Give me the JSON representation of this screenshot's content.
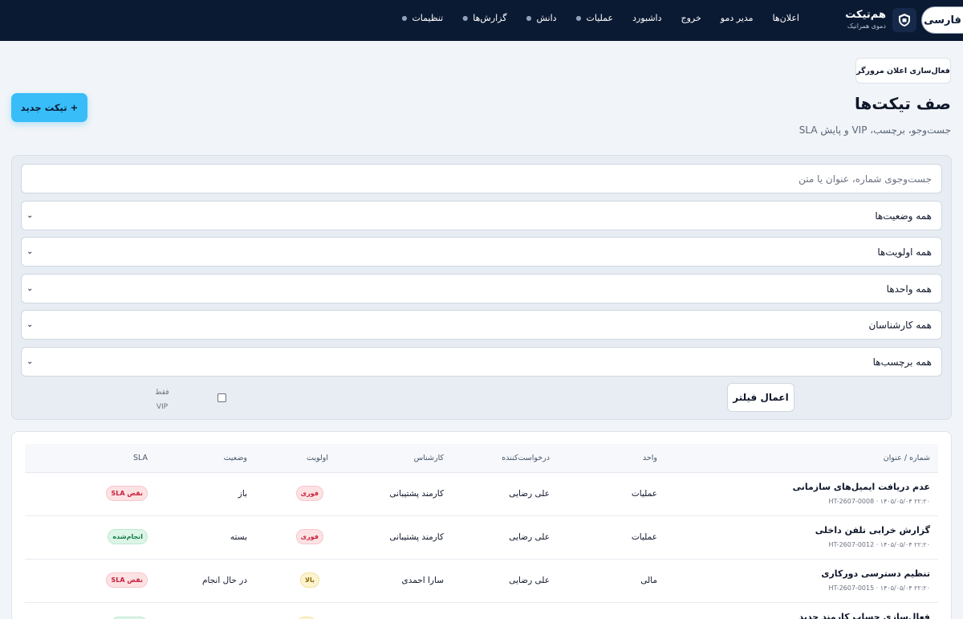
{
  "topbar": {
    "language": "فارسی",
    "brand_name": "هم‌تیکت",
    "brand_sub": "دموی همرانیک",
    "nav": [
      {
        "label": "اعلان‌ها",
        "dropdown": false
      },
      {
        "label": "مدیر دمو",
        "dropdown": false
      },
      {
        "label": "خروج",
        "dropdown": false
      },
      {
        "label": "داشبورد",
        "dropdown": false
      },
      {
        "label": "عملیات",
        "dropdown": true
      },
      {
        "label": "دانش",
        "dropdown": true
      },
      {
        "label": "گزارش‌ها",
        "dropdown": true
      },
      {
        "label": "تنظیمات",
        "dropdown": true
      }
    ]
  },
  "header": {
    "notify_button": "فعال‌سازی اعلان مرورگر",
    "title": "صف تیکت‌ها",
    "subtitle": "جست‌وجو، برچسب، VIP و پایش SLA",
    "new_ticket": "+ تیکت جدید"
  },
  "filters": {
    "search_placeholder": "جست‌وجوی شماره، عنوان یا متن",
    "status": "همه وضعیت‌ها",
    "priority": "همه اولویت‌ها",
    "unit": "همه واحدها",
    "agent": "همه کارشناسان",
    "tag": "همه برچسب‌ها",
    "vip_label_1": "فقط",
    "vip_label_2": "VIP",
    "vip_checked": false,
    "apply": "اعمال فیلتر"
  },
  "table": {
    "headers": {
      "title": "شماره / عنوان",
      "unit": "واحد",
      "requester": "درخواست‌کننده",
      "agent": "کارشناس",
      "priority": "اولویت",
      "status": "وضعیت",
      "sla": "SLA"
    },
    "rows": [
      {
        "title": "عدم دریافت ایمیل‌های سازمانی",
        "meta": "HT-2607-0008 · ۱۴۰۵/۰۵/۰۴ ۲۲:۲۰",
        "unit": "عملیات",
        "requester": "علی رضایی",
        "agent": "کارمند پشتیبانی",
        "priority": "فوری",
        "priority_color": "#c81e3a",
        "status": "باز",
        "sla": "نقض SLA",
        "sla_color": "#c81e3a"
      },
      {
        "title": "گزارش خرابی تلفن داخلی",
        "meta": "HT-2607-0012 · ۱۴۰۵/۰۵/۰۴ ۲۲:۲۰",
        "unit": "عملیات",
        "requester": "علی رضایی",
        "agent": "کارمند پشتیبانی",
        "priority": "فوری",
        "priority_color": "#c81e3a",
        "status": "بسته",
        "sla": "انجام‌شده",
        "sla_color": "#127a45"
      },
      {
        "title": "تنظیم دسترسی دورکاری",
        "meta": "HT-2607-0015 · ۱۴۰۵/۰۵/۰۴ ۲۲:۲۰",
        "unit": "مالی",
        "requester": "علی رضایی",
        "agent": "سارا احمدی",
        "priority": "بالا",
        "priority_color": "#8a6a00",
        "status": "در حال انجام",
        "sla": "نقض SLA",
        "sla_color": "#c81e3a"
      },
      {
        "title": "فعال‌سازی حساب کارمند جدید",
        "meta": "",
        "unit": "",
        "requester": "",
        "agent": "",
        "priority": "",
        "status": "",
        "sla": ""
      }
    ]
  }
}
